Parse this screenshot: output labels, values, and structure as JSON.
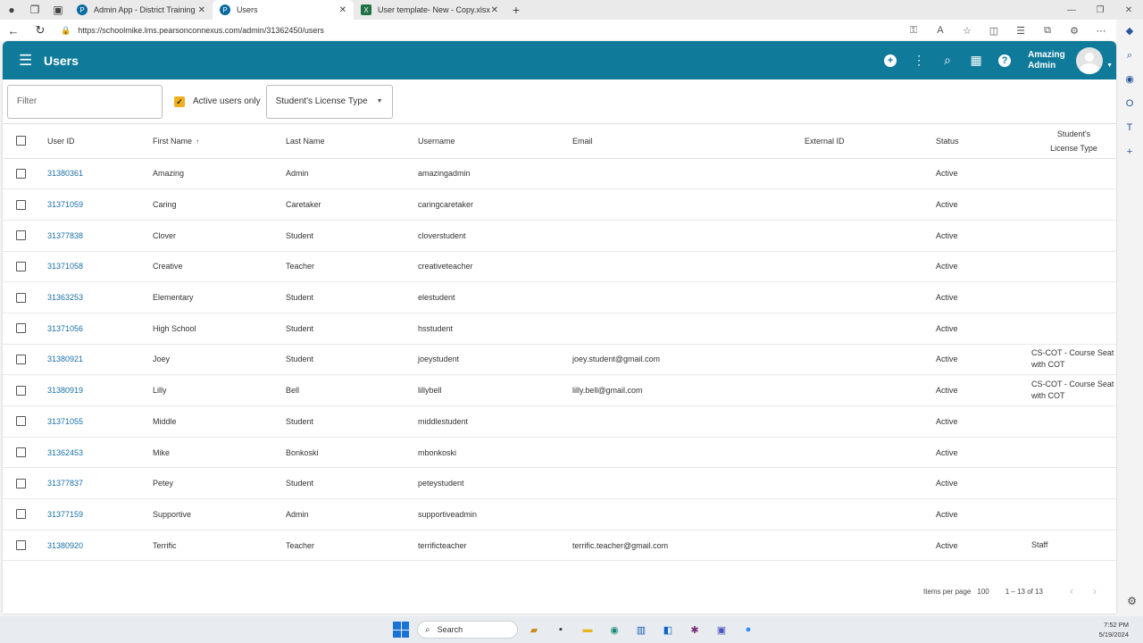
{
  "browser": {
    "tabs": [
      {
        "title": "Admin App - District Training",
        "icon": "pearson-icon",
        "active": false
      },
      {
        "title": "Users",
        "icon": "pearson-icon",
        "active": true
      },
      {
        "title": "User template- New - Copy.xlsx",
        "icon": "excel-icon",
        "active": false
      }
    ],
    "url": "https://schoolmike.lms.pearsonconnexus.com/admin/31362450/users"
  },
  "appbar": {
    "title": "Users",
    "user_first": "Amazing",
    "user_last": "Admin"
  },
  "filters": {
    "filter_placeholder": "Filter",
    "active_only_label": "Active users only",
    "active_only_checked": true,
    "license_select": "Student's License Type"
  },
  "table": {
    "headers": {
      "user_id": "User ID",
      "first_name": "First Name",
      "last_name": "Last Name",
      "username": "Username",
      "email": "Email",
      "external_id": "External ID",
      "status": "Status",
      "license_line1": "Student's",
      "license_line2": "License Type"
    },
    "rows": [
      {
        "id": "31380361",
        "first": "Amazing",
        "last": "Admin",
        "username": "amazingadmin",
        "email": "",
        "external": "",
        "status": "Active",
        "license": ""
      },
      {
        "id": "31371059",
        "first": "Caring",
        "last": "Caretaker",
        "username": "caringcaretaker",
        "email": "",
        "external": "",
        "status": "Active",
        "license": ""
      },
      {
        "id": "31377838",
        "first": "Clover",
        "last": "Student",
        "username": "cloverstudent",
        "email": "",
        "external": "",
        "status": "Active",
        "license": ""
      },
      {
        "id": "31371058",
        "first": "Creative",
        "last": "Teacher",
        "username": "creativeteacher",
        "email": "",
        "external": "",
        "status": "Active",
        "license": ""
      },
      {
        "id": "31363253",
        "first": "Elementary",
        "last": "Student",
        "username": "elestudent",
        "email": "",
        "external": "",
        "status": "Active",
        "license": ""
      },
      {
        "id": "31371056",
        "first": "High School",
        "last": "Student",
        "username": "hsstudent",
        "email": "",
        "external": "",
        "status": "Active",
        "license": ""
      },
      {
        "id": "31380921",
        "first": "Joey",
        "last": "Student",
        "username": "joeystudent",
        "email": "joey.student@gmail.com",
        "external": "",
        "status": "Active",
        "license": "CS-COT - Course Seat with COT"
      },
      {
        "id": "31380919",
        "first": "Lilly",
        "last": "Bell",
        "username": "lillybell",
        "email": "lilly.bell@gmail.com",
        "external": "",
        "status": "Active",
        "license": "CS-COT - Course Seat with COT"
      },
      {
        "id": "31371055",
        "first": "Middle",
        "last": "Student",
        "username": "middlestudent",
        "email": "",
        "external": "",
        "status": "Active",
        "license": ""
      },
      {
        "id": "31362453",
        "first": "Mike",
        "last": "Bonkoski",
        "username": "mbonkoski",
        "email": "",
        "external": "",
        "status": "Active",
        "license": ""
      },
      {
        "id": "31377837",
        "first": "Petey",
        "last": "Student",
        "username": "peteystudent",
        "email": "",
        "external": "",
        "status": "Active",
        "license": ""
      },
      {
        "id": "31377159",
        "first": "Supportive",
        "last": "Admin",
        "username": "supportiveadmin",
        "email": "",
        "external": "",
        "status": "Active",
        "license": ""
      },
      {
        "id": "31380920",
        "first": "Terrific",
        "last": "Teacher",
        "username": "terrificteacher",
        "email": "terrific.teacher@gmail.com",
        "external": "",
        "status": "Active",
        "license": "Staff"
      }
    ]
  },
  "pagination": {
    "items_per_page_label": "Items per page",
    "items_per_page": "100",
    "range": "1 – 13 of 13"
  },
  "taskbar": {
    "search_label": "Search",
    "time": "7:52 PM",
    "date": "5/19/2024"
  },
  "colors": {
    "appbar": "#0f7a9a",
    "link": "#1a6fa6",
    "checkbox_accent": "#f2b01e"
  }
}
